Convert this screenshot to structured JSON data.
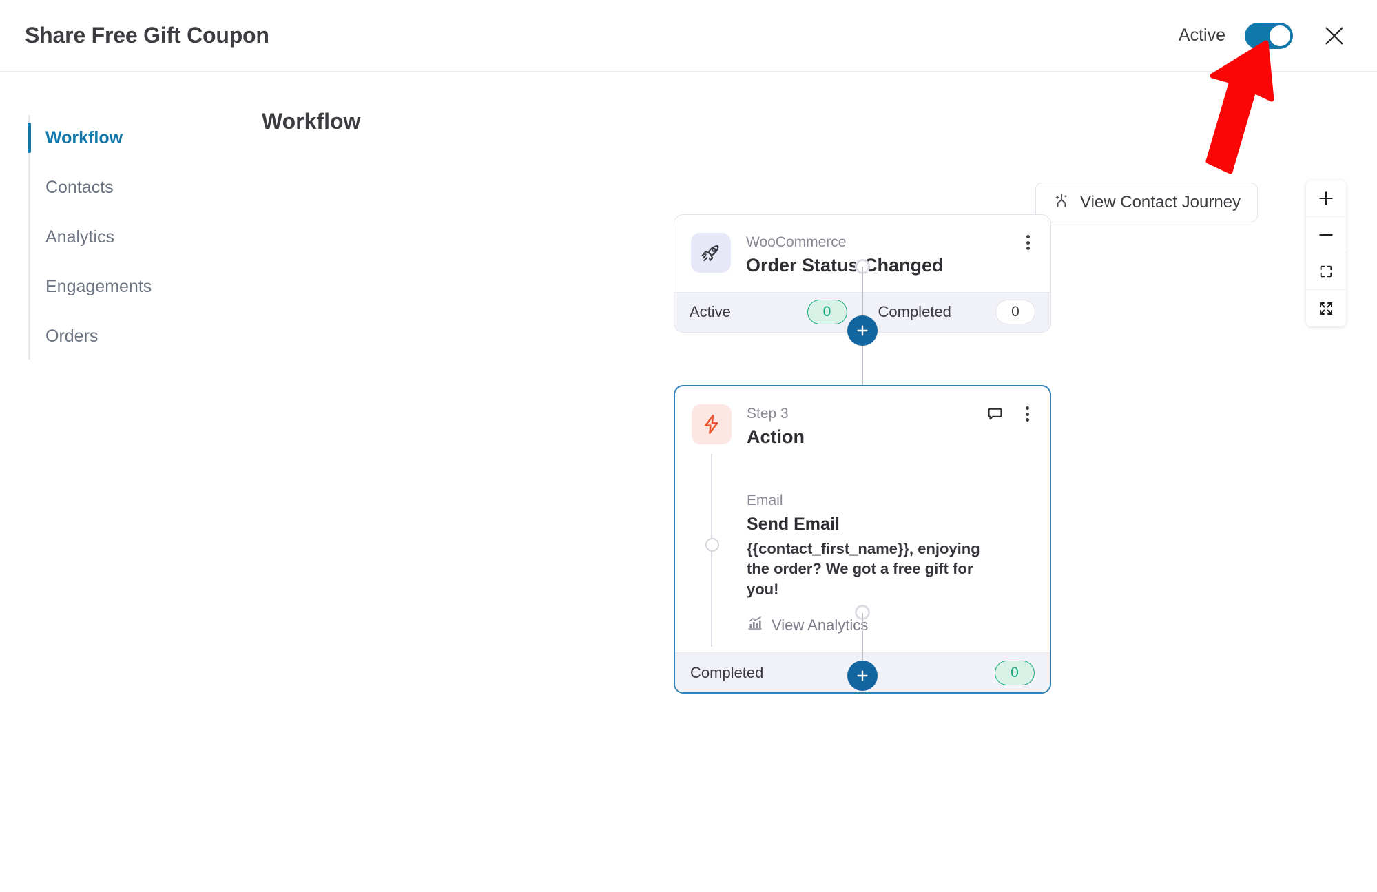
{
  "header": {
    "title": "Share Free Gift Coupon",
    "status_label": "Active",
    "toggle_on": true,
    "close_icon": "close-icon",
    "accent_color": "#1178ac"
  },
  "sidebar": {
    "items": [
      {
        "label": "Workflow",
        "active": true
      },
      {
        "label": "Contacts",
        "active": false
      },
      {
        "label": "Analytics",
        "active": false
      },
      {
        "label": "Engagements",
        "active": false
      },
      {
        "label": "Orders",
        "active": false
      }
    ]
  },
  "main": {
    "title": "Workflow",
    "journey_button": {
      "label": "View Contact Journey",
      "icon": "journey-branch-icon"
    },
    "zoom_controls": [
      {
        "name": "zoom-in",
        "icon": "plus-icon"
      },
      {
        "name": "zoom-out",
        "icon": "minus-icon"
      },
      {
        "name": "fit-view",
        "icon": "fit-screen-icon"
      },
      {
        "name": "full-screen",
        "icon": "expand-arrows-icon"
      }
    ]
  },
  "workflow": {
    "trigger_node": {
      "icon": "rocket-icon",
      "source": "WooCommerce",
      "title": "Order Status Changed",
      "kebab_icon": "more-vertical-icon",
      "stats": [
        {
          "label": "Active",
          "value": "0",
          "style": "green"
        },
        {
          "label": "Completed",
          "value": "0",
          "style": "white"
        }
      ]
    },
    "action_node": {
      "icon": "lightning-bolt-icon",
      "step_label": "Step 3",
      "title": "Action",
      "comment_icon": "comment-bubble-icon",
      "kebab_icon": "more-vertical-icon",
      "detail": {
        "type": "Email",
        "name": "Send Email",
        "description": "{{contact_first_name}}, enjoying the order? We got a free gift for you!",
        "analytics_link": "View Analytics",
        "analytics_icon": "bar-chart-icon"
      },
      "stats": [
        {
          "label": "Completed",
          "value": "0",
          "style": "green"
        }
      ]
    },
    "add_buttons": [
      {
        "name": "add-step-after-trigger",
        "icon": "plus-icon"
      },
      {
        "name": "add-step-after-action",
        "icon": "plus-icon"
      }
    ]
  },
  "annotation": {
    "type": "red-arrow",
    "points_to": "Active"
  }
}
